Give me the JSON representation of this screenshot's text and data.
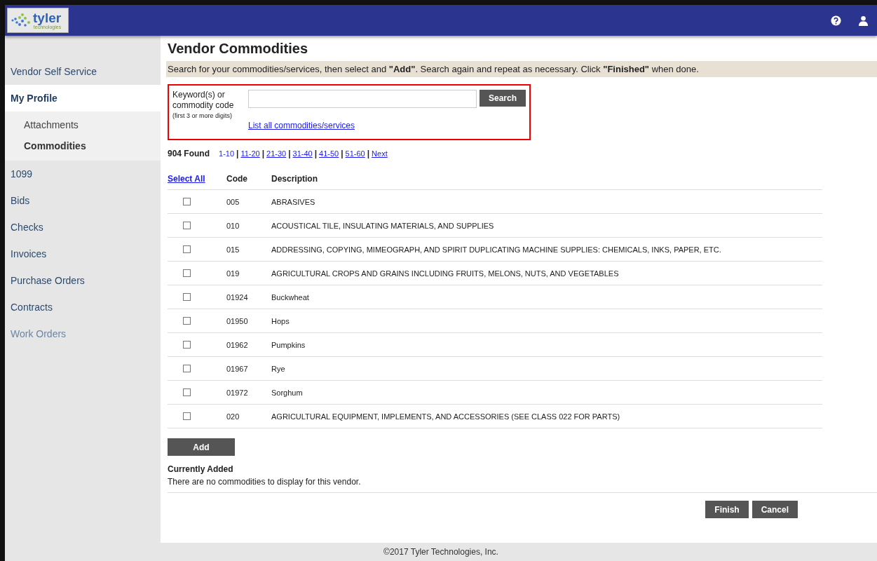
{
  "header": {
    "logo": "tyler",
    "logo_sub": "technologies"
  },
  "sidebar": {
    "items": [
      {
        "label": "Vendor Self Service",
        "selected": false,
        "disabled": false
      },
      {
        "label": "My Profile",
        "selected": true,
        "disabled": false,
        "children": [
          {
            "label": "Attachments",
            "selected": false
          },
          {
            "label": "Commodities",
            "selected": true
          }
        ]
      },
      {
        "label": "1099",
        "selected": false,
        "disabled": false
      },
      {
        "label": "Bids",
        "selected": false,
        "disabled": false
      },
      {
        "label": "Checks",
        "selected": false,
        "disabled": false
      },
      {
        "label": "Invoices",
        "selected": false,
        "disabled": false
      },
      {
        "label": "Purchase Orders",
        "selected": false,
        "disabled": false
      },
      {
        "label": "Contracts",
        "selected": false,
        "disabled": false
      },
      {
        "label": "Work Orders",
        "selected": false,
        "disabled": true
      }
    ]
  },
  "page_title": "Vendor Commodities",
  "instructions": "Search for your commodities/services, then select and **\"Add\"**. Search again and repeat as necessary. Click **\"Finished\"** when done.",
  "search": {
    "label": "Keyword(s) or commodity code",
    "hint": "(first 3 or more digits)",
    "button": "Search",
    "list_all_link": "List all commodities/services"
  },
  "results": {
    "count": "904 Found",
    "separator": "|",
    "pages": [
      {
        "label": "1-10",
        "selected": true
      },
      {
        "label": "11-20",
        "selected": false
      },
      {
        "label": "21-30",
        "selected": false
      },
      {
        "label": "31-40",
        "selected": false
      },
      {
        "label": "41-50",
        "selected": false
      },
      {
        "label": "51-60",
        "selected": false
      },
      {
        "label": "Next",
        "selected": false
      }
    ]
  },
  "table": {
    "select_all": "Select All",
    "columns": [
      "Code",
      "Description"
    ],
    "rows": [
      {
        "checked": false,
        "code": "005",
        "description": "ABRASIVES"
      },
      {
        "checked": false,
        "code": "010",
        "description": "ACOUSTICAL TILE, INSULATING MATERIALS, AND SUPPLIES"
      },
      {
        "checked": false,
        "code": "015",
        "description": "ADDRESSING, COPYING, MIMEOGRAPH, AND SPIRIT DUPLICATING MACHINE SUPPLIES: CHEMICALS, INKS, PAPER, ETC."
      },
      {
        "checked": false,
        "code": "019",
        "description": "AGRICULTURAL CROPS AND GRAINS INCLUDING FRUITS, MELONS, NUTS, AND VEGETABLES"
      },
      {
        "checked": false,
        "code": "01924",
        "description": "Buckwheat"
      },
      {
        "checked": false,
        "code": "01950",
        "description": "Hops"
      },
      {
        "checked": false,
        "code": "01962",
        "description": "Pumpkins"
      },
      {
        "checked": false,
        "code": "01967",
        "description": "Rye"
      },
      {
        "checked": false,
        "code": "01972",
        "description": "Sorghum"
      },
      {
        "checked": false,
        "code": "020",
        "description": "AGRICULTURAL EQUIPMENT, IMPLEMENTS, AND ACCESSORIES (SEE CLASS 022 FOR PARTS)"
      }
    ]
  },
  "add_button": "Add",
  "currently_added": {
    "title": "Currently Added",
    "message": "There are no commodities to display for this vendor."
  },
  "buttons": [
    "Finish",
    "Cancel"
  ],
  "footer": "©2017 Tyler Technologies, Inc."
}
